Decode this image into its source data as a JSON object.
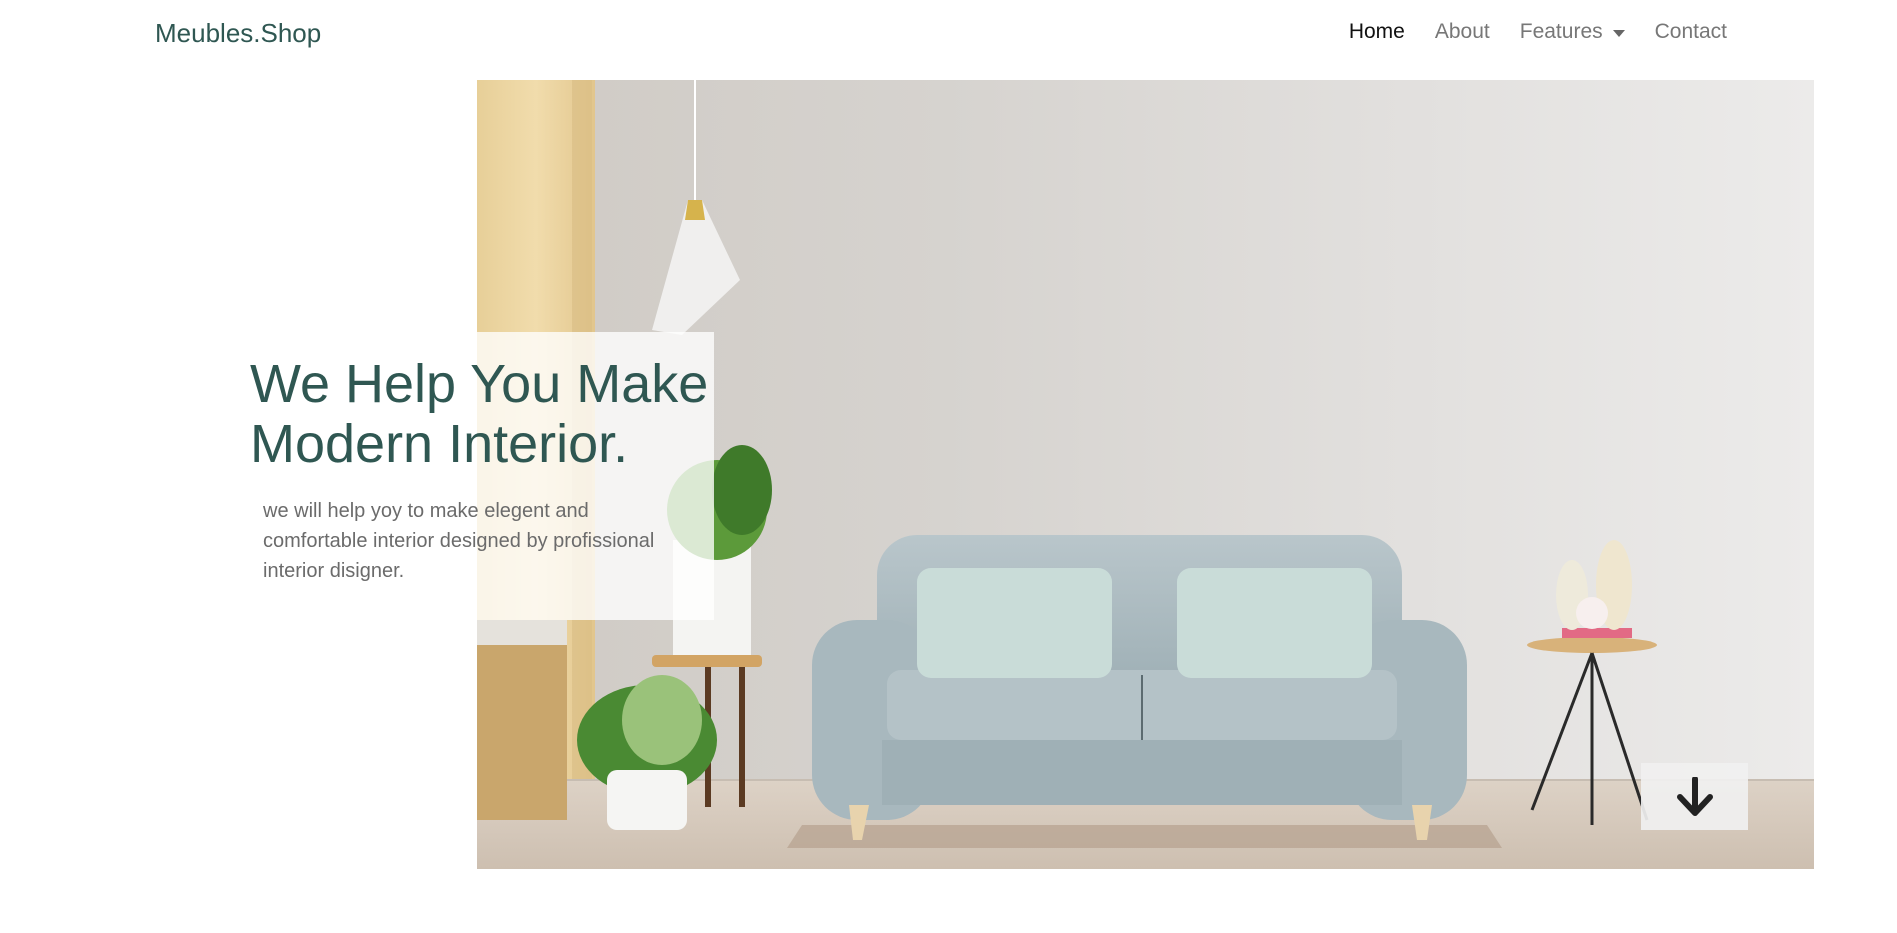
{
  "navbar": {
    "brand": "Meubles.Shop",
    "links": [
      {
        "label": "Home",
        "active": true
      },
      {
        "label": "About",
        "active": false
      },
      {
        "label": "Features",
        "active": false,
        "dropdown": true
      },
      {
        "label": "Contact",
        "active": false
      }
    ]
  },
  "hero": {
    "title_line1": "We Help You Make",
    "title_line2": "Modern Interior.",
    "description": "we will help yoy to make elegent and comfortable interior designed by profissional interior disigner.",
    "scroll_icon": "arrow-down-icon",
    "image_subject": "living room with sofa"
  },
  "colors": {
    "brand": "#2f5752",
    "nav_active": "#111111",
    "nav_inactive": "#777777",
    "body_text": "#6b6b6b"
  }
}
